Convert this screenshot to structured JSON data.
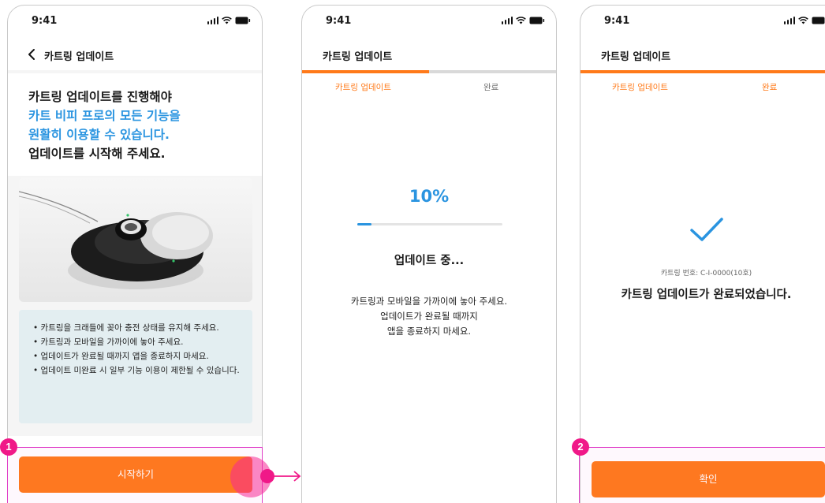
{
  "status_time": "9:41",
  "screen1": {
    "nav_title": "카트링 업데이트",
    "intro": {
      "line1": "카트링 업데이트를 진행해야",
      "line2": "카트 비피 프로의 모든 기능을",
      "line3": "원활히 이용할 수 있습니다.",
      "line4": "업데이트를 시작해 주세요."
    },
    "notices": [
      "• 카트링을 크래들에 꽂아 충전 상태를 유지해 주세요.",
      "• 카트링과 모바일을 가까이에 놓아 주세요.",
      "• 업데이트가 완료될 때까지 앱을 종료하지 마세요.",
      "• 업데이트 미완료 시 일부 기능 이용이 제한될 수 있습니다."
    ],
    "start_button": "시작하기"
  },
  "screen2": {
    "nav_title": "카트링 업데이트",
    "steps": [
      "카트링 업데이트",
      "완료"
    ],
    "step_progress": 0.5,
    "percent": "10%",
    "progress": 0.1,
    "status": "업데이트 중...",
    "message": [
      "카트링과 모바일을 가까이에 놓아 주세요.",
      "업데이트가 완료될 때까지",
      "앱을 종료하지 마세요."
    ]
  },
  "screen3": {
    "nav_title": "카트링 업데이트",
    "steps": [
      "카트링 업데이트",
      "완료"
    ],
    "step_progress": 1.0,
    "serial": "카트링 번호: C-I-0000(10호)",
    "done_message": "카트링 업데이트가 완료되었습니다.",
    "confirm_button": "확인"
  },
  "annotations": [
    "1",
    "2"
  ],
  "colors": {
    "accent": "#ff7a1a",
    "blue": "#2a94e0",
    "annotation": "#f01888"
  }
}
